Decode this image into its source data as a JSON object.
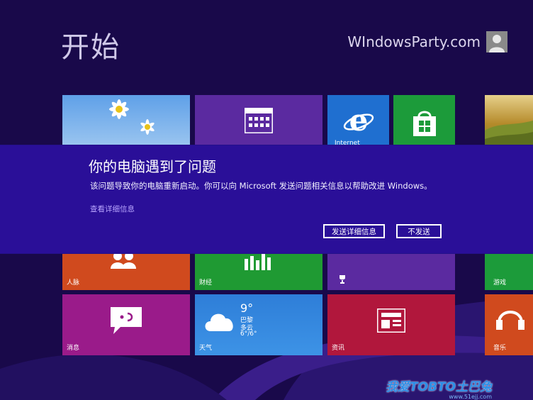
{
  "start": {
    "title": "开始"
  },
  "user": {
    "name": "WIndowsParty.com",
    "avatar_icon": "person-silhouette-icon"
  },
  "tiles": {
    "desktop": {
      "icon": "daisy-flower-image"
    },
    "calendar": {
      "icon": "calendar-icon"
    },
    "ie": {
      "label": "Internet",
      "icon": "internet-explorer-icon"
    },
    "store": {
      "icon": "store-bag-icon"
    },
    "photo": {
      "icon": "landscape-photo"
    },
    "people": {
      "label": "人脉",
      "icon": "people-icon"
    },
    "finance": {
      "label": "财经",
      "icon": "bar-chart-icon"
    },
    "sports": {
      "icon": "trophy-icon"
    },
    "games": {
      "label": "游戏",
      "icon": "game-icon"
    },
    "messaging": {
      "label": "消息",
      "icon": "chat-bubble-icon"
    },
    "weather": {
      "label": "天气",
      "temp": "9°",
      "city": "巴黎",
      "condition": "多云",
      "range": "6°/6°",
      "icon": "cloud-icon"
    },
    "news": {
      "label": "资讯",
      "icon": "newspaper-icon"
    },
    "music": {
      "label": "音乐",
      "icon": "headphones-icon"
    }
  },
  "dialog": {
    "title": "你的电脑遇到了问题",
    "message": "该问题导致你的电脑重新启动。你可以向 Microsoft 发送问题相关信息以帮助改进 Windows。",
    "details_link": "查看详细信息",
    "send_button": "发送详细信息",
    "dont_send_button": "不发送"
  },
  "watermark": {
    "text": "我爱TOBTO土巴兔",
    "sub": "www.51ejj.com"
  },
  "colors": {
    "background": "#19094a",
    "dialog": "#2a0f98",
    "people": "#d04a1e",
    "finance": "#1f9a33",
    "messaging": "#9a1b8a",
    "weather": "#2f7fd8",
    "news": "#b1173c",
    "calendar": "#5b2aa0",
    "ie": "#1f6fd0",
    "store": "#1c9b3a"
  }
}
